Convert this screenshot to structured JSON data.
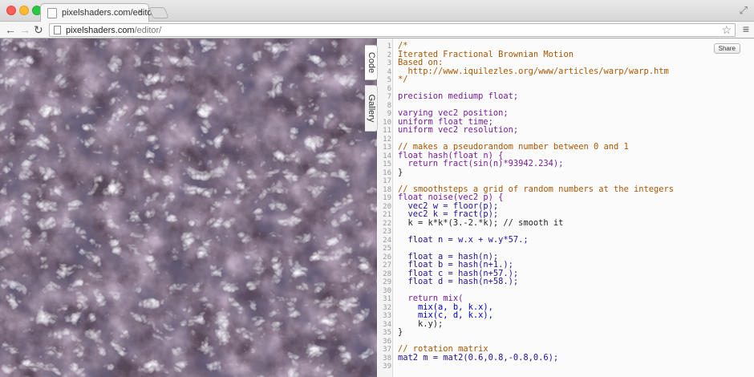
{
  "browser": {
    "tab_title": "pixelshaders.com/editor/",
    "tab_close": "×",
    "url_host": "pixelshaders.com",
    "url_path": "/editor/",
    "back_icon": "←",
    "forward_icon": "→",
    "reload_icon": "↻",
    "star_icon": "☆",
    "menu_icon": "≡",
    "fullscreen_icon": "⤢"
  },
  "side_tabs": {
    "code": "Code",
    "gallery": "Gallery"
  },
  "share_label": "Share",
  "colors": {
    "comment": "#aa5500",
    "keyword": "#7a1aa0",
    "type": "#221199",
    "function": "#0000cc",
    "number": "#116644"
  },
  "code": [
    {
      "n": "1",
      "t": "/*",
      "c": "comment"
    },
    {
      "n": "2",
      "t": "Iterated Fractional Brownian Motion",
      "c": "comment"
    },
    {
      "n": "3",
      "t": "Based on:",
      "c": "comment"
    },
    {
      "n": "4",
      "t": "  http://www.iquilezles.org/www/articles/warp/warp.htm",
      "c": "comment"
    },
    {
      "n": "5",
      "t": "*/",
      "c": "comment"
    },
    {
      "n": "6",
      "t": "",
      "c": "plain"
    },
    {
      "n": "7",
      "t": "precision mediump float;",
      "c": "keyword"
    },
    {
      "n": "8",
      "t": "",
      "c": "plain"
    },
    {
      "n": "9",
      "t": "varying vec2 position;",
      "c": "keyword"
    },
    {
      "n": "10",
      "t": "uniform float time;",
      "c": "keyword"
    },
    {
      "n": "11",
      "t": "uniform vec2 resolution;",
      "c": "keyword"
    },
    {
      "n": "12",
      "t": "",
      "c": "plain"
    },
    {
      "n": "13",
      "t": "// makes a pseudorandom number between 0 and 1",
      "c": "comment"
    },
    {
      "n": "14",
      "t": "float hash(float n) {",
      "c": "keyword"
    },
    {
      "n": "15",
      "t": "  return fract(sin(n)*93942.234);",
      "c": "keyword"
    },
    {
      "n": "16",
      "t": "}",
      "c": "plain"
    },
    {
      "n": "17",
      "t": "",
      "c": "plain"
    },
    {
      "n": "18",
      "t": "// smoothsteps a grid of random numbers at the integers",
      "c": "comment"
    },
    {
      "n": "19",
      "t": "float noise(vec2 p) {",
      "c": "keyword"
    },
    {
      "n": "20",
      "t": "  vec2 w = floor(p);",
      "c": "type"
    },
    {
      "n": "21",
      "t": "  vec2 k = fract(p);",
      "c": "type"
    },
    {
      "n": "22",
      "t": "  k = k*k*(3.-2.*k); // smooth it",
      "c": "plain"
    },
    {
      "n": "23",
      "t": "",
      "c": "plain"
    },
    {
      "n": "24",
      "t": "  float n = w.x + w.y*57.;",
      "c": "type"
    },
    {
      "n": "25",
      "t": "",
      "c": "plain"
    },
    {
      "n": "26",
      "t": "  float a = hash(n);",
      "c": "type"
    },
    {
      "n": "27",
      "t": "  float b = hash(n+1.);",
      "c": "type"
    },
    {
      "n": "28",
      "t": "  float c = hash(n+57.);",
      "c": "type"
    },
    {
      "n": "29",
      "t": "  float d = hash(n+58.);",
      "c": "type"
    },
    {
      "n": "30",
      "t": "",
      "c": "plain"
    },
    {
      "n": "31",
      "t": "  return mix(",
      "c": "keyword"
    },
    {
      "n": "32",
      "t": "    mix(a, b, k.x),",
      "c": "func"
    },
    {
      "n": "33",
      "t": "    mix(c, d, k.x),",
      "c": "func"
    },
    {
      "n": "34",
      "t": "    k.y);",
      "c": "plain"
    },
    {
      "n": "35",
      "t": "}",
      "c": "plain"
    },
    {
      "n": "36",
      "t": "",
      "c": "plain"
    },
    {
      "n": "37",
      "t": "// rotation matrix",
      "c": "comment"
    },
    {
      "n": "38",
      "t": "mat2 m = mat2(0.6,0.8,-0.8,0.6);",
      "c": "type"
    },
    {
      "n": "39",
      "t": "",
      "c": "plain"
    }
  ]
}
